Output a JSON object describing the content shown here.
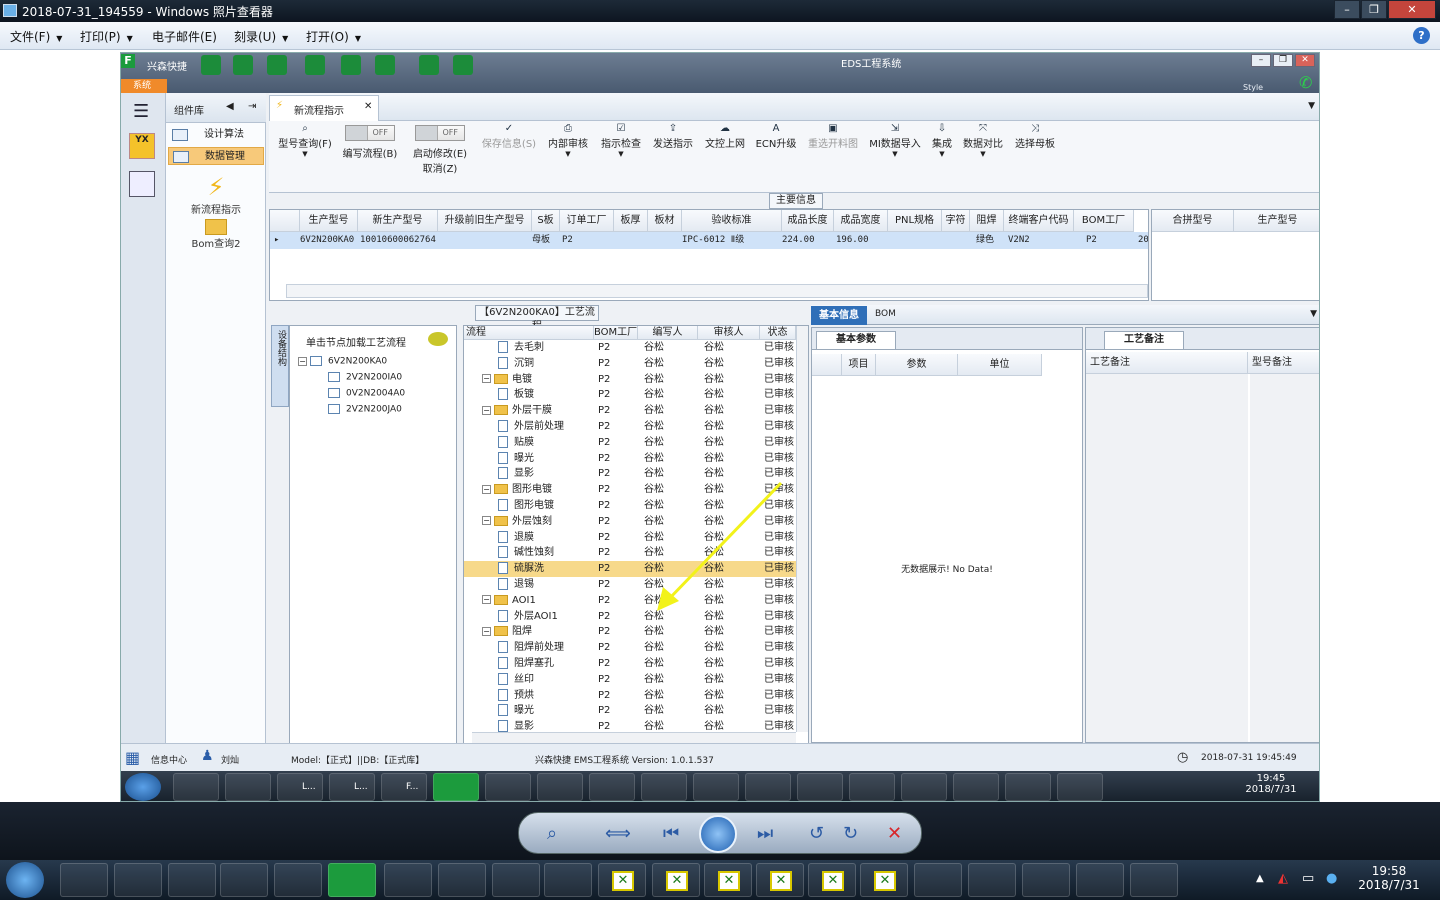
{
  "viewer": {
    "title": "2018-07-31_194559 - Windows 照片查看器",
    "menu": [
      "文件(F)",
      "打印(P)",
      "电子邮件(E)",
      "刻录(U)",
      "打开(O)"
    ],
    "help": "?",
    "win_buttons": [
      "–",
      "❐",
      "✕"
    ]
  },
  "app": {
    "brand": "兴森快捷",
    "title": "EDS工程系统",
    "sys_tab": "系统",
    "style_label": "Style",
    "sidebar": {
      "header": "组件库",
      "items": [
        "设计算法",
        "数据管理"
      ],
      "tools": [
        "新流程指示",
        "Bom查询2"
      ]
    },
    "nav_icons": [
      "menu-icon",
      "yx-icon",
      "calc-icon"
    ],
    "tab": "新流程指示",
    "ribbon": [
      {
        "label": "型号查询(F)",
        "icon": "search-icon",
        "disabled": false
      },
      {
        "label": "编写流程(B)",
        "toggle": "OFF"
      },
      {
        "label": "启动修改(E)",
        "sub": "取消(Z)",
        "toggle": "OFF"
      },
      {
        "label": "保存信息(S)",
        "icon": "check-icon",
        "disabled": true
      },
      {
        "label": "内部审核",
        "icon": "print-icon",
        "disabled": false
      },
      {
        "label": "指示检查",
        "icon": "check-icon",
        "disabled": false
      },
      {
        "label": "发送指示",
        "icon": "upload-icon",
        "disabled": false
      },
      {
        "label": "文控上网",
        "icon": "cloud-icon",
        "disabled": false
      },
      {
        "label": "ECN升级",
        "icon": "a-icon",
        "disabled": false
      },
      {
        "label": "重选开料图",
        "icon": "image-icon",
        "disabled": true
      },
      {
        "label": "MI数据导入",
        "icon": "import-icon",
        "disabled": false
      },
      {
        "label": "集成",
        "icon": "download-icon",
        "disabled": false
      },
      {
        "label": "数据对比",
        "icon": "compare-icon",
        "disabled": false
      },
      {
        "label": "选择母板",
        "icon": "shuffle-icon",
        "disabled": false
      }
    ],
    "main_info": {
      "title": "主要信息",
      "columns": [
        "生产型号",
        "新生产型号",
        "升级前旧生产型号",
        "S板",
        "订单工厂",
        "板厚",
        "板材",
        "验收标准",
        "成品长度",
        "成品宽度",
        "PNL规格",
        "字符",
        "阻焊",
        "终端客户代码",
        "BOM工厂"
      ],
      "row": [
        "6V2N200KA0",
        "10010600062764",
        "",
        "母板",
        "P2",
        "",
        "",
        "IPC-6012 Ⅱ级",
        "224.00",
        "196.00",
        "",
        "",
        "绿色",
        "V2N2",
        "P2",
        "20"
      ],
      "side_columns": [
        "合拼型号",
        "生产型号"
      ]
    },
    "flow": {
      "title": "【6V2N200KA0】工艺流程",
      "side_tab": "设备结构",
      "hint": "单击节点加载工艺流程",
      "tree": [
        "6V2N200KA0",
        "2V2N200IA0",
        "0V2N2004A0",
        "2V2N200JA0"
      ],
      "columns": [
        "流程",
        "BOM工厂",
        "编写人",
        "审核人",
        "状态"
      ],
      "rows": [
        {
          "name": "去毛刺",
          "level": 2,
          "type": "doc",
          "bom": "P2",
          "writer": "谷松",
          "reviewer": "谷松",
          "status": "已审核"
        },
        {
          "name": "沉铜",
          "level": 2,
          "type": "doc",
          "bom": "P2",
          "writer": "谷松",
          "reviewer": "谷松",
          "status": "已审核"
        },
        {
          "name": "电镀",
          "level": 1,
          "type": "folder",
          "bom": "P2",
          "writer": "谷松",
          "reviewer": "谷松",
          "status": "已审核"
        },
        {
          "name": "板镀",
          "level": 2,
          "type": "doc",
          "bom": "P2",
          "writer": "谷松",
          "reviewer": "谷松",
          "status": "已审核"
        },
        {
          "name": "外层干膜",
          "level": 1,
          "type": "folder",
          "bom": "P2",
          "writer": "谷松",
          "reviewer": "谷松",
          "status": "已审核"
        },
        {
          "name": "外层前处理",
          "level": 2,
          "type": "doc",
          "bom": "P2",
          "writer": "谷松",
          "reviewer": "谷松",
          "status": "已审核"
        },
        {
          "name": "贴膜",
          "level": 2,
          "type": "doc",
          "bom": "P2",
          "writer": "谷松",
          "reviewer": "谷松",
          "status": "已审核"
        },
        {
          "name": "曝光",
          "level": 2,
          "type": "doc",
          "bom": "P2",
          "writer": "谷松",
          "reviewer": "谷松",
          "status": "已审核"
        },
        {
          "name": "显影",
          "level": 2,
          "type": "doc",
          "bom": "P2",
          "writer": "谷松",
          "reviewer": "谷松",
          "status": "已审核"
        },
        {
          "name": "图形电镀",
          "level": 1,
          "type": "folder",
          "bom": "P2",
          "writer": "谷松",
          "reviewer": "谷松",
          "status": "已审核"
        },
        {
          "name": "图形电镀",
          "level": 2,
          "type": "doc",
          "bom": "P2",
          "writer": "谷松",
          "reviewer": "谷松",
          "status": "已审核"
        },
        {
          "name": "外层蚀刻",
          "level": 1,
          "type": "folder",
          "bom": "P2",
          "writer": "谷松",
          "reviewer": "谷松",
          "status": "已审核"
        },
        {
          "name": "退膜",
          "level": 2,
          "type": "doc",
          "bom": "P2",
          "writer": "谷松",
          "reviewer": "谷松",
          "status": "已审核"
        },
        {
          "name": "碱性蚀刻",
          "level": 2,
          "type": "doc",
          "bom": "P2",
          "writer": "谷松",
          "reviewer": "谷松",
          "status": "已审核"
        },
        {
          "name": "硫脲洗",
          "level": 2,
          "type": "doc",
          "bom": "P2",
          "writer": "谷松",
          "reviewer": "谷松",
          "status": "已审核",
          "selected": true
        },
        {
          "name": "退锡",
          "level": 2,
          "type": "doc",
          "bom": "P2",
          "writer": "谷松",
          "reviewer": "谷松",
          "status": "已审核"
        },
        {
          "name": "AOI1",
          "level": 1,
          "type": "folder",
          "bom": "P2",
          "writer": "谷松",
          "reviewer": "谷松",
          "status": "已审核"
        },
        {
          "name": "外层AOI1",
          "level": 2,
          "type": "doc",
          "bom": "P2",
          "writer": "谷松",
          "reviewer": "谷松",
          "status": "已审核"
        },
        {
          "name": "阻焊",
          "level": 1,
          "type": "folder",
          "bom": "P2",
          "writer": "谷松",
          "reviewer": "谷松",
          "status": "已审核"
        },
        {
          "name": "阻焊前处理",
          "level": 2,
          "type": "doc",
          "bom": "P2",
          "writer": "谷松",
          "reviewer": "谷松",
          "status": "已审核"
        },
        {
          "name": "阻焊塞孔",
          "level": 2,
          "type": "doc",
          "bom": "P2",
          "writer": "谷松",
          "reviewer": "谷松",
          "status": "已审核"
        },
        {
          "name": "丝印",
          "level": 2,
          "type": "doc",
          "bom": "P2",
          "writer": "谷松",
          "reviewer": "谷松",
          "status": "已审核"
        },
        {
          "name": "预烘",
          "level": 2,
          "type": "doc",
          "bom": "P2",
          "writer": "谷松",
          "reviewer": "谷松",
          "status": "已审核"
        },
        {
          "name": "曝光",
          "level": 2,
          "type": "doc",
          "bom": "P2",
          "writer": "谷松",
          "reviewer": "谷松",
          "status": "已审核"
        },
        {
          "name": "显影",
          "level": 2,
          "type": "doc",
          "bom": "P2",
          "writer": "谷松",
          "reviewer": "谷松",
          "status": "已审核"
        }
      ]
    },
    "right": {
      "tabs": [
        "基本信息",
        "BOM"
      ],
      "sub_tab": "基本参数",
      "param_columns": [
        "项目",
        "参数",
        "单位"
      ],
      "no_data": "无数据展示! No Data!",
      "notes_tab": "工艺备注",
      "notes_columns": [
        "工艺备注",
        "型号备注"
      ]
    },
    "status": {
      "info_center": "信息中心",
      "user": "刘灿",
      "model_db": "Model:【正式】||DB:【正式库】",
      "version": "兴森快捷 EMS工程系统 Version: 1.0.1.537",
      "datetime": "2018-07-31 19:45:49"
    },
    "inner_taskbar": {
      "labels": [
        "L...",
        "L...",
        "F..."
      ],
      "time": "19:45",
      "date": "2018/7/31"
    }
  },
  "taskbar": {
    "time": "19:58",
    "date": "2018/7/31"
  },
  "colors": {
    "selected_row": "#f7d98a",
    "accent": "#2e6fc8",
    "annotation_arrow": "#f2f21a",
    "brand_green": "#1c9b3d"
  }
}
